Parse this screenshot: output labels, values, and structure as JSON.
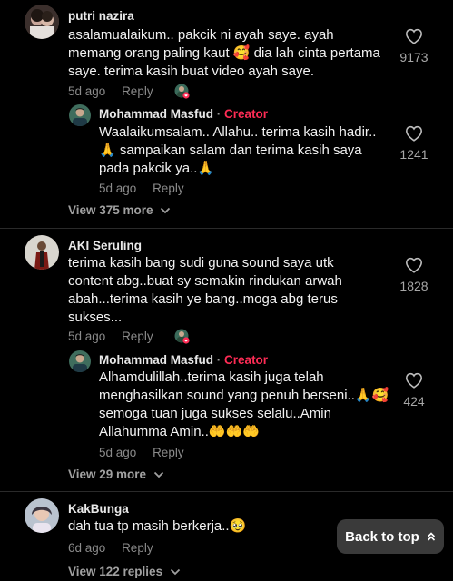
{
  "comments": [
    {
      "username": "putri nazira",
      "lines": [
        "asalamualaikum.. pakcik ni ayah saye. ayah",
        "memang orang paling kaut 🥰 dia lah cinta pertama",
        "saye. terima kasih buat video ayah saye."
      ],
      "time": "5d ago",
      "reply_label": "Reply",
      "likes": "9173",
      "reply": {
        "username": "Mohammad Masfud",
        "separator": "·",
        "badge": "Creator",
        "lines": [
          "Waalaikumsalam.. Allahu.. terima kasih hadir..",
          "🙏 sampaikan salam dan terima kasih saya",
          "pada pakcik ya..🙏"
        ],
        "time": "5d ago",
        "reply_label": "Reply",
        "likes": "1241"
      },
      "view_more": "View 375 more"
    },
    {
      "username": "AKI Seruling",
      "lines": [
        "terima kasih bang sudi guna sound saya utk",
        "content abg..buat sy semakin rindukan arwah",
        "abah...terima kasih ye bang..moga abg terus",
        "sukses..."
      ],
      "time": "5d ago",
      "reply_label": "Reply",
      "likes": "1828",
      "reply": {
        "username": "Mohammad Masfud",
        "separator": "·",
        "badge": "Creator",
        "lines": [
          "Alhamdulillah..terima kasih juga telah",
          "menghasilkan sound yang penuh berseni..🙏🥰",
          "semoga tuan juga sukses selalu..Amin",
          "Allahumma Amin..🤲🤲🤲"
        ],
        "time": "5d ago",
        "reply_label": "Reply",
        "likes": "424"
      },
      "view_more": "View 29 more"
    },
    {
      "username": "KakBunga",
      "lines": [
        "dah tua tp masih berkerja..🥹"
      ],
      "time": "6d ago",
      "reply_label": "Reply",
      "view_more": "View 122 replies"
    }
  ],
  "back_to_top": "Back to top",
  "colors": {
    "background": "#000000",
    "creator": "#fe2c55",
    "muted": "#8a8a8a"
  },
  "icons": {
    "like": "heart-outline-icon",
    "chevron": "chevron-down-icon",
    "back_to_top": "double-chevron-up-icon",
    "liked_by_creator": "creator-liked-badge-icon"
  }
}
